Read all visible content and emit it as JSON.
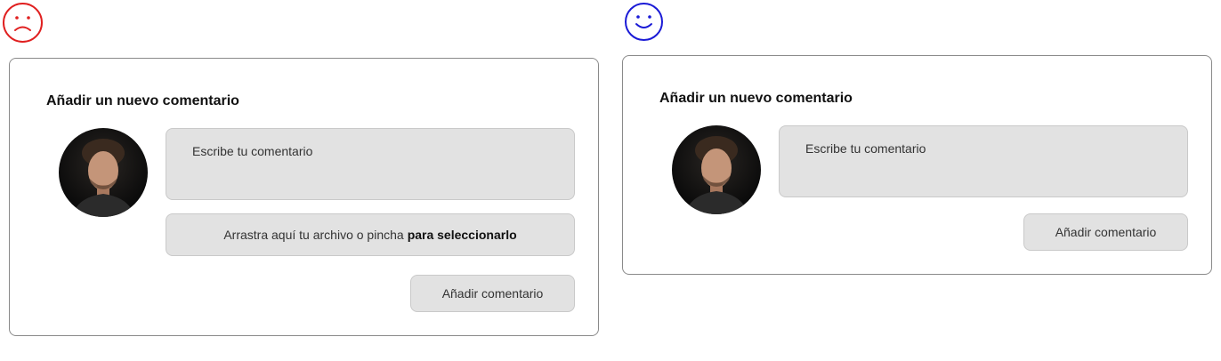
{
  "bad_example": {
    "indicator": {
      "icon": "sad-face-icon",
      "color": "#e02020"
    },
    "card": {
      "title": "Añadir un nuevo comentario",
      "comment_placeholder": "Escribe tu comentario",
      "dropzone_text": "Arrastra aquí tu archivo o pincha",
      "dropzone_link": "para seleccionarlo",
      "submit_label": "Añadir comentario"
    }
  },
  "good_example": {
    "indicator": {
      "icon": "happy-face-icon",
      "color": "#1a1ad6"
    },
    "card": {
      "title": "Añadir un nuevo comentario",
      "comment_placeholder": "Escribe tu comentario",
      "submit_label": "Añadir comentario"
    }
  }
}
